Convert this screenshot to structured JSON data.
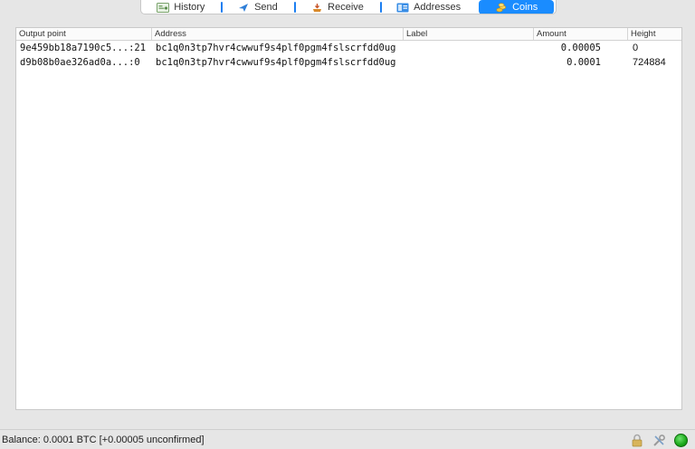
{
  "tabs": [
    {
      "label": "History",
      "icon": "history-icon",
      "active": false
    },
    {
      "label": "Send",
      "icon": "send-icon",
      "active": false
    },
    {
      "label": "Receive",
      "icon": "receive-icon",
      "active": false
    },
    {
      "label": "Addresses",
      "icon": "addresses-icon",
      "active": false
    },
    {
      "label": "Coins",
      "icon": "coins-icon",
      "active": true
    }
  ],
  "table": {
    "headers": {
      "output_point": "Output point",
      "address": "Address",
      "label": "Label",
      "amount": "Amount",
      "height": "Height"
    },
    "rows": [
      {
        "output_point": "9e459bb18a7190c5...:21",
        "address": "bc1q0n3tp7hvr4cwwuf9s4plf0pgm4fslscrfdd0ug",
        "label": "",
        "amount": "0.00005",
        "height": "0"
      },
      {
        "output_point": "d9b08b0ae326ad0a...:0",
        "address": "bc1q0n3tp7hvr4cwwuf9s4plf0pgm4fslscrfdd0ug",
        "label": "",
        "amount": "0.0001",
        "height": "724884"
      }
    ]
  },
  "status": {
    "balance": "Balance: 0.0001 BTC  [+0.00005 unconfirmed]",
    "icons": [
      "lock-icon",
      "tools-icon",
      "network-status-icon"
    ]
  },
  "colors": {
    "accent": "#1a8cff",
    "status_ok": "#1aa81a"
  }
}
